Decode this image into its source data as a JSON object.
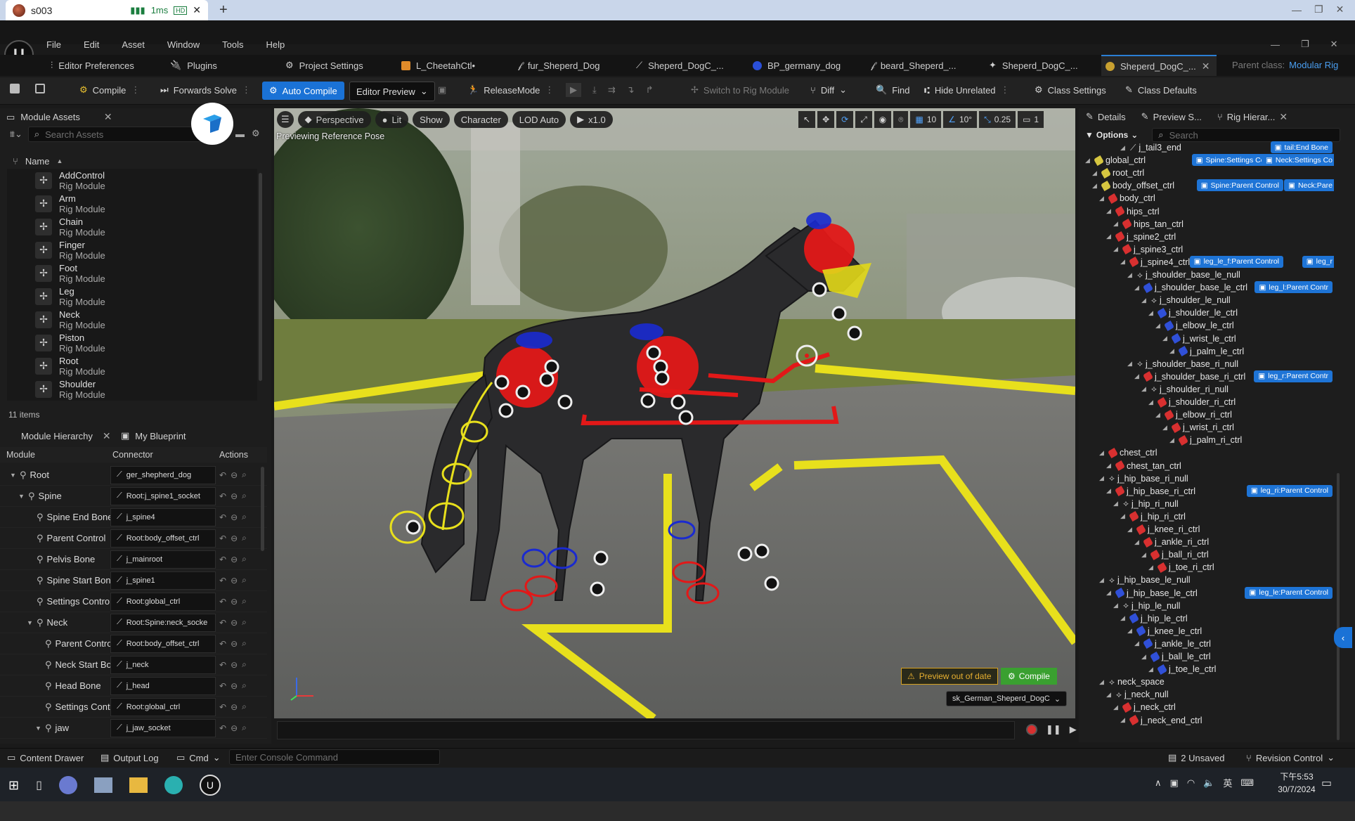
{
  "browser": {
    "tab_title": "s003",
    "latency": "1ms",
    "hd": "HD",
    "close": "✕",
    "plus": "+"
  },
  "editor": {
    "menu": [
      "File",
      "Edit",
      "Asset",
      "Window",
      "Tools",
      "Help"
    ],
    "asset_tabs": [
      "Editor Preferences",
      "Plugins",
      "Project Settings",
      "L_CheetahCtl•",
      "fur_Sheperd_Dog",
      "Sheperd_DogC_...",
      "BP_germany_dog",
      "beard_Sheperd_...",
      "Sheperd_DogC_...",
      "Sheperd_DogC_..."
    ],
    "parent_class_label": "Parent class:",
    "parent_class_value": "Modular Rig",
    "toolbar": {
      "compile": "Compile",
      "forwards_solve": "Forwards Solve",
      "auto_compile": "Auto Compile",
      "editor_preview": "Editor Preview",
      "release_mode": "ReleaseMode",
      "switch_rig": "Switch to Rig Module",
      "diff": "Diff",
      "find": "Find",
      "hide_unrelated": "Hide Unrelated",
      "class_settings": "Class Settings",
      "class_defaults": "Class Defaults"
    },
    "module_assets": {
      "tab": "Module Assets",
      "search_placeholder": "Search Assets",
      "col_name": "Name",
      "items": [
        {
          "name": "AddControl",
          "type": "Rig Module"
        },
        {
          "name": "Arm",
          "type": "Rig Module"
        },
        {
          "name": "Chain",
          "type": "Rig Module"
        },
        {
          "name": "Finger",
          "type": "Rig Module"
        },
        {
          "name": "Foot",
          "type": "Rig Module"
        },
        {
          "name": "Leg",
          "type": "Rig Module"
        },
        {
          "name": "Neck",
          "type": "Rig Module"
        },
        {
          "name": "Piston",
          "type": "Rig Module"
        },
        {
          "name": "Root",
          "type": "Rig Module"
        },
        {
          "name": "Shoulder",
          "type": "Rig Module"
        }
      ],
      "count": "11 items"
    },
    "hierarchy": {
      "tab1": "Module Hierarchy",
      "tab2": "My Blueprint",
      "col_module": "Module",
      "col_connector": "Connector",
      "col_actions": "Actions",
      "rows": [
        {
          "module": "Root",
          "connector": "ger_shepherd_dog",
          "depth": 0
        },
        {
          "module": "Spine",
          "connector": "Root:j_spine1_socket",
          "depth": 1
        },
        {
          "module": "Spine End Bone",
          "connector": "j_spine4",
          "depth": 2
        },
        {
          "module": "Parent Control",
          "connector": "Root:body_offset_ctrl",
          "depth": 2
        },
        {
          "module": "Pelvis Bone",
          "connector": "j_mainroot",
          "depth": 2
        },
        {
          "module": "Spine Start Bone",
          "connector": "j_spine1",
          "depth": 2
        },
        {
          "module": "Settings Control",
          "connector": "Root:global_ctrl",
          "depth": 2
        },
        {
          "module": "Neck",
          "connector": "Root:Spine:neck_socke",
          "depth": 2
        },
        {
          "module": "Parent Control",
          "connector": "Root:body_offset_ctrl",
          "depth": 3
        },
        {
          "module": "Neck Start Bone",
          "connector": "j_neck",
          "depth": 3
        },
        {
          "module": "Head Bone",
          "connector": "j_head",
          "depth": 3
        },
        {
          "module": "Settings Contro",
          "connector": "Root:global_ctrl",
          "depth": 3
        },
        {
          "module": "jaw",
          "connector": "j_jaw_socket",
          "depth": 3
        }
      ]
    },
    "viewport": {
      "perspective": "Perspective",
      "lit": "Lit",
      "show": "Show",
      "character": "Character",
      "lod": "LOD Auto",
      "speed": "x1.0",
      "grid": "10",
      "angle": "10°",
      "scale": "0.25",
      "cam": "1",
      "status": "Previewing Reference Pose",
      "preview_out_of_date": "Preview out of date",
      "compile": "Compile",
      "mesh": "sk_German_Sheperd_DogC"
    },
    "right_panel": {
      "tab_details": "Details",
      "tab_preview": "Preview S...",
      "tab_rig": "Rig Hierar...",
      "options": "Options",
      "search_placeholder": "Search",
      "tree": [
        {
          "name": "j_tail3_end",
          "depth": 5,
          "kind": "bone",
          "chip": "tail:End Bone"
        },
        {
          "name": "global_ctrl",
          "depth": 0,
          "kind": "ctrl",
          "color": "#d6c640",
          "chip": "Spine:Settings Control",
          "chip2": "Neck:Settings Co"
        },
        {
          "name": "root_ctrl",
          "depth": 1,
          "kind": "ctrl",
          "color": "#d6c640"
        },
        {
          "name": "body_offset_ctrl",
          "depth": 1,
          "kind": "ctrl",
          "color": "#d6c640",
          "chip": "Spine:Parent Control",
          "chip2": "Neck:Pare"
        },
        {
          "name": "body_ctrl",
          "depth": 2,
          "kind": "ctrl",
          "color": "#d83030"
        },
        {
          "name": "hips_ctrl",
          "depth": 3,
          "kind": "ctrl",
          "color": "#d83030"
        },
        {
          "name": "hips_tan_ctrl",
          "depth": 4,
          "kind": "ctrl",
          "color": "#d83030"
        },
        {
          "name": "j_spine2_ctrl",
          "depth": 3,
          "kind": "ctrl",
          "color": "#d83030"
        },
        {
          "name": "j_spine3_ctrl",
          "depth": 4,
          "kind": "ctrl",
          "color": "#d83030"
        },
        {
          "name": "j_spine4_ctrl",
          "depth": 5,
          "kind": "ctrl",
          "color": "#d83030",
          "chip": "leg_le_f:Parent Control",
          "chip2": "leg_r"
        },
        {
          "name": "j_shoulder_base_le_null",
          "depth": 6,
          "kind": "null"
        },
        {
          "name": "j_shoulder_base_le_ctrl",
          "depth": 7,
          "kind": "ctrl",
          "color": "#3050d8",
          "chip": "leg_l:Parent Contr"
        },
        {
          "name": "j_shoulder_le_null",
          "depth": 8,
          "kind": "null"
        },
        {
          "name": "j_shoulder_le_ctrl",
          "depth": 9,
          "kind": "ctrl",
          "color": "#3050d8"
        },
        {
          "name": "j_elbow_le_ctrl",
          "depth": 10,
          "kind": "ctrl",
          "color": "#3050d8"
        },
        {
          "name": "j_wrist_le_ctrl",
          "depth": 11,
          "kind": "ctrl",
          "color": "#3050d8"
        },
        {
          "name": "j_palm_le_ctrl",
          "depth": 12,
          "kind": "ctrl",
          "color": "#3050d8"
        },
        {
          "name": "j_shoulder_base_ri_null",
          "depth": 6,
          "kind": "null"
        },
        {
          "name": "j_shoulder_base_ri_ctrl",
          "depth": 7,
          "kind": "ctrl",
          "color": "#d83030",
          "chip": "leg_r:Parent Contr"
        },
        {
          "name": "j_shoulder_ri_null",
          "depth": 8,
          "kind": "null"
        },
        {
          "name": "j_shoulder_ri_ctrl",
          "depth": 9,
          "kind": "ctrl",
          "color": "#d83030"
        },
        {
          "name": "j_elbow_ri_ctrl",
          "depth": 10,
          "kind": "ctrl",
          "color": "#d83030"
        },
        {
          "name": "j_wrist_ri_ctrl",
          "depth": 11,
          "kind": "ctrl",
          "color": "#d83030"
        },
        {
          "name": "j_palm_ri_ctrl",
          "depth": 12,
          "kind": "ctrl",
          "color": "#d83030"
        },
        {
          "name": "chest_ctrl",
          "depth": 2,
          "kind": "ctrl",
          "color": "#d83030"
        },
        {
          "name": "chest_tan_ctrl",
          "depth": 3,
          "kind": "ctrl",
          "color": "#d83030"
        },
        {
          "name": "j_hip_base_ri_null",
          "depth": 2,
          "kind": "null"
        },
        {
          "name": "j_hip_base_ri_ctrl",
          "depth": 3,
          "kind": "ctrl",
          "color": "#d83030",
          "chip": "leg_ri:Parent Control"
        },
        {
          "name": "j_hip_ri_null",
          "depth": 4,
          "kind": "null"
        },
        {
          "name": "j_hip_ri_ctrl",
          "depth": 5,
          "kind": "ctrl",
          "color": "#d83030"
        },
        {
          "name": "j_knee_ri_ctrl",
          "depth": 6,
          "kind": "ctrl",
          "color": "#d83030"
        },
        {
          "name": "j_ankle_ri_ctrl",
          "depth": 7,
          "kind": "ctrl",
          "color": "#d83030"
        },
        {
          "name": "j_ball_ri_ctrl",
          "depth": 8,
          "kind": "ctrl",
          "color": "#d83030"
        },
        {
          "name": "j_toe_ri_ctrl",
          "depth": 9,
          "kind": "ctrl",
          "color": "#d83030"
        },
        {
          "name": "j_hip_base_le_null",
          "depth": 2,
          "kind": "null"
        },
        {
          "name": "j_hip_base_le_ctrl",
          "depth": 3,
          "kind": "ctrl",
          "color": "#3050d8",
          "chip": "leg_le:Parent Control"
        },
        {
          "name": "j_hip_le_null",
          "depth": 4,
          "kind": "null"
        },
        {
          "name": "j_hip_le_ctrl",
          "depth": 5,
          "kind": "ctrl",
          "color": "#3050d8"
        },
        {
          "name": "j_knee_le_ctrl",
          "depth": 6,
          "kind": "ctrl",
          "color": "#3050d8"
        },
        {
          "name": "j_ankle_le_ctrl",
          "depth": 7,
          "kind": "ctrl",
          "color": "#3050d8"
        },
        {
          "name": "j_ball_le_ctrl",
          "depth": 8,
          "kind": "ctrl",
          "color": "#3050d8"
        },
        {
          "name": "j_toe_le_ctrl",
          "depth": 9,
          "kind": "ctrl",
          "color": "#3050d8"
        },
        {
          "name": "neck_space",
          "depth": 2,
          "kind": "null"
        },
        {
          "name": "j_neck_null",
          "depth": 3,
          "kind": "null"
        },
        {
          "name": "j_neck_ctrl",
          "depth": 4,
          "kind": "ctrl",
          "color": "#d83030"
        },
        {
          "name": "j_neck_end_ctrl",
          "depth": 5,
          "kind": "ctrl",
          "color": "#d83030"
        }
      ]
    },
    "statusbar": {
      "content_drawer": "Content Drawer",
      "output_log": "Output Log",
      "cmd": "Cmd",
      "console_placeholder": "Enter Console Command",
      "unsaved": "2 Unsaved",
      "revision": "Revision Control"
    }
  },
  "taskbar": {
    "ime": "英",
    "time": "下午5:53",
    "date": "30/7/2024"
  },
  "colors": {
    "accent": "#1a72d6",
    "ctrl_red": "#d83030",
    "ctrl_blue": "#3050d8",
    "ctrl_yellow": "#d6c640"
  }
}
